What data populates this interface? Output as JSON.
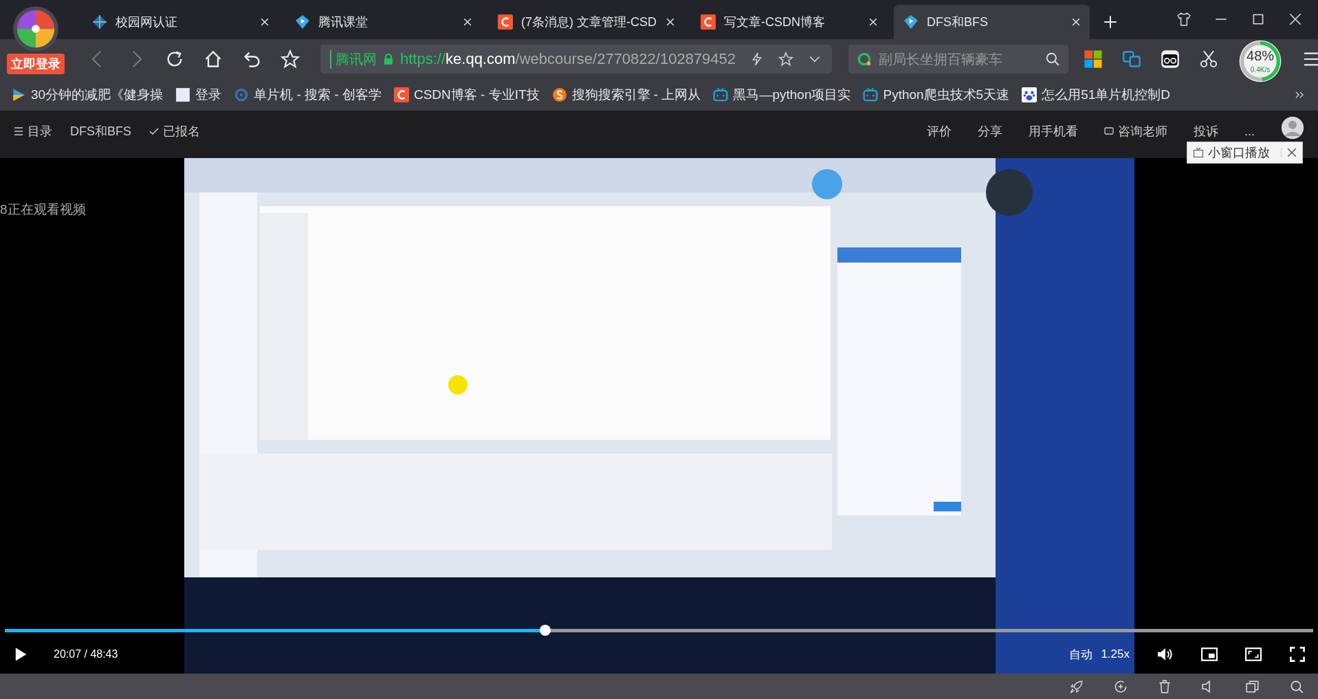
{
  "browser": {
    "login_badge": "立即登录",
    "tabs": [
      {
        "title": "校园网认证",
        "kind": "globe",
        "selected": false
      },
      {
        "title": "腾讯课堂",
        "kind": "tencent",
        "selected": false
      },
      {
        "title": "(7条消息) 文章管理-CSD",
        "kind": "csdn",
        "selected": false
      },
      {
        "title": "写文章-CSDN博客",
        "kind": "csdn",
        "selected": false
      },
      {
        "title": "DFS和BFS",
        "kind": "tencent",
        "selected": true
      }
    ],
    "address": {
      "site_label": "腾讯网",
      "scheme": "https://",
      "host": "ke.qq.com",
      "path": "/webcourse/2770822/102879452"
    },
    "search": {
      "placeholder": "副局长坐拥百辆豪车"
    },
    "speed_meter": {
      "percent": "48%",
      "rate": "0.4K/s",
      "level": 0.48
    },
    "bookmarks": [
      {
        "title": "30分钟的减肥《健身操",
        "kind": "video"
      },
      {
        "title": "登录",
        "kind": "page"
      },
      {
        "title": "单片机 - 搜索 - 创客学",
        "kind": "search"
      },
      {
        "title": "CSDN博客 - 专业IT技",
        "kind": "csdn"
      },
      {
        "title": "搜狗搜索引擎 - 上网从",
        "kind": "sogou"
      },
      {
        "title": "黑马—python项目实",
        "kind": "bilibili"
      },
      {
        "title": "Python爬虫技术5天速",
        "kind": "bilibili"
      },
      {
        "title": "怎么用51单片机控制D",
        "kind": "baidu"
      }
    ]
  },
  "course_header": {
    "menu": "目录",
    "title": "DFS和BFS",
    "enrolled": "已报名",
    "actions": [
      "评价",
      "分享",
      "用手机看",
      "咨询老师",
      "投诉",
      "..."
    ],
    "mini_window": "小窗口播放"
  },
  "player": {
    "viewers": "8正在观看视频",
    "time": "20:07 / 48:43",
    "progress": {
      "level": 0.413
    },
    "quality": "自动",
    "speed": "1.25x"
  }
}
